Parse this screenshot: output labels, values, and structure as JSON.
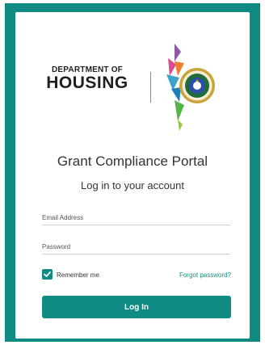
{
  "logo": {
    "department_of": "DEPARTMENT OF",
    "housing": "HOUSING",
    "seal_icon": "puerto-rico-seal-emblem"
  },
  "colors": {
    "accent": "#0f8b83",
    "background": "#ffffff",
    "text": "#333333"
  },
  "portal": {
    "title": "Grant Compliance Portal",
    "subtitle": "Log in to your account"
  },
  "form": {
    "email_placeholder": "Email Address",
    "email_value": "",
    "password_placeholder": "Password",
    "password_value": "",
    "remember_label": "Remember me",
    "remember_checked": true,
    "forgot_label": "Forgot password?",
    "login_label": "Log In"
  }
}
